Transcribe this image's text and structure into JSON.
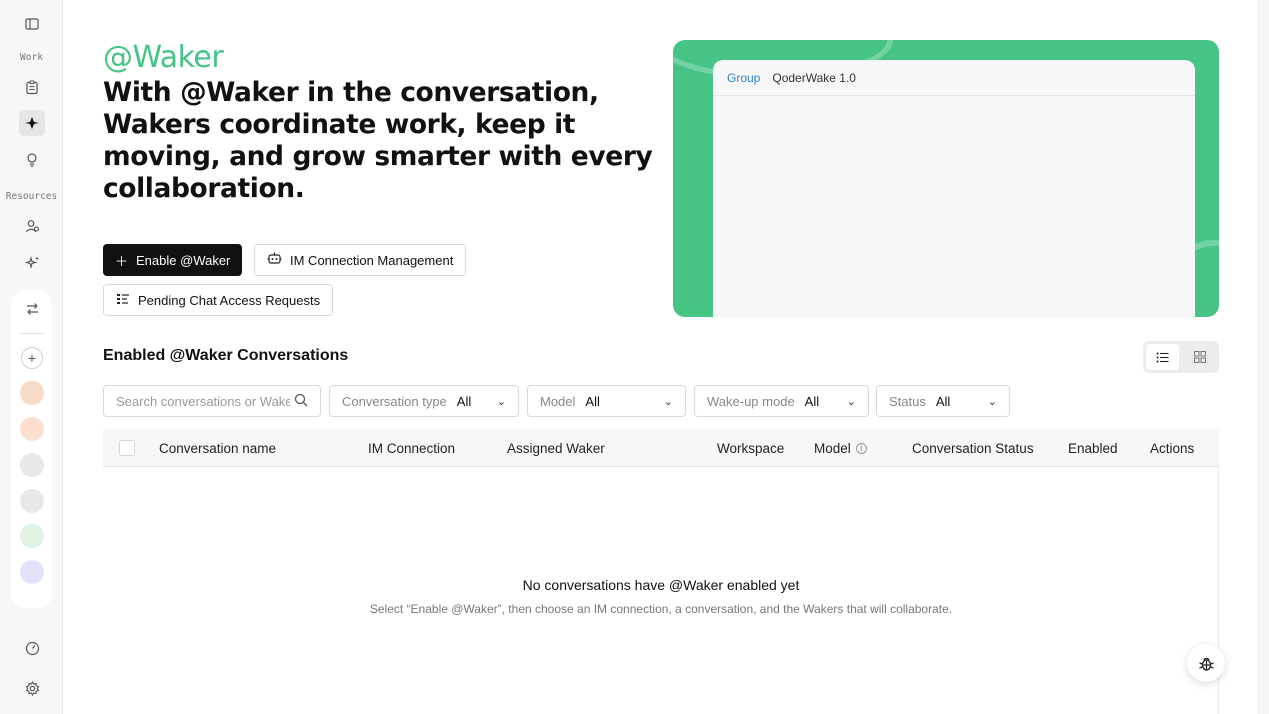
{
  "sidebar": {
    "section_work": "Work",
    "section_resources": "Resources",
    "add_label": "+",
    "icons": {
      "toggle": "sidebar-toggle-icon",
      "tasks": "clipboard-icon",
      "waker": "waker-icon",
      "ideas": "lightbulb-icon",
      "people": "people-icon",
      "sparkle": "sparkle-icon",
      "switch": "swap-icon",
      "dashboard": "gauge-icon",
      "settings": "gear-icon"
    },
    "avatar_colors": [
      "#f6dcc6",
      "#fbe0cf",
      "#e8e8e8",
      "#e8e8e8",
      "#dff2e3",
      "#e0e2f7"
    ]
  },
  "hero": {
    "brand": "@Waker",
    "headline": "With @Waker in the conversation, Wakers coordinate work, keep it moving, and grow smarter with every collaboration.",
    "accent_color": "#45c486"
  },
  "actions": {
    "enable_label": "Enable @Waker",
    "im_label": "IM Connection Management",
    "pending_label": "Pending Chat Access Requests"
  },
  "preview": {
    "tab_group": "Group",
    "tab_name": "QoderWake 1.0"
  },
  "section": {
    "title": "Enabled @Waker Conversations"
  },
  "filters": {
    "search_placeholder": "Search conversations or Wakers",
    "conversation_type": {
      "label": "Conversation type",
      "value": "All"
    },
    "model": {
      "label": "Model",
      "value": "All"
    },
    "wake_up_mode": {
      "label": "Wake-up mode",
      "value": "All"
    },
    "status": {
      "label": "Status",
      "value": "All"
    }
  },
  "table": {
    "columns": [
      "Conversation name",
      "IM Connection",
      "Assigned Waker",
      "Workspace",
      "Model",
      "Conversation Status",
      "Enabled",
      "Actions"
    ]
  },
  "empty": {
    "title": "No conversations have @Waker enabled yet",
    "subtitle": "Select “Enable @Waker”, then choose an IM connection, a conversation, and the Wakers that will collaborate."
  }
}
